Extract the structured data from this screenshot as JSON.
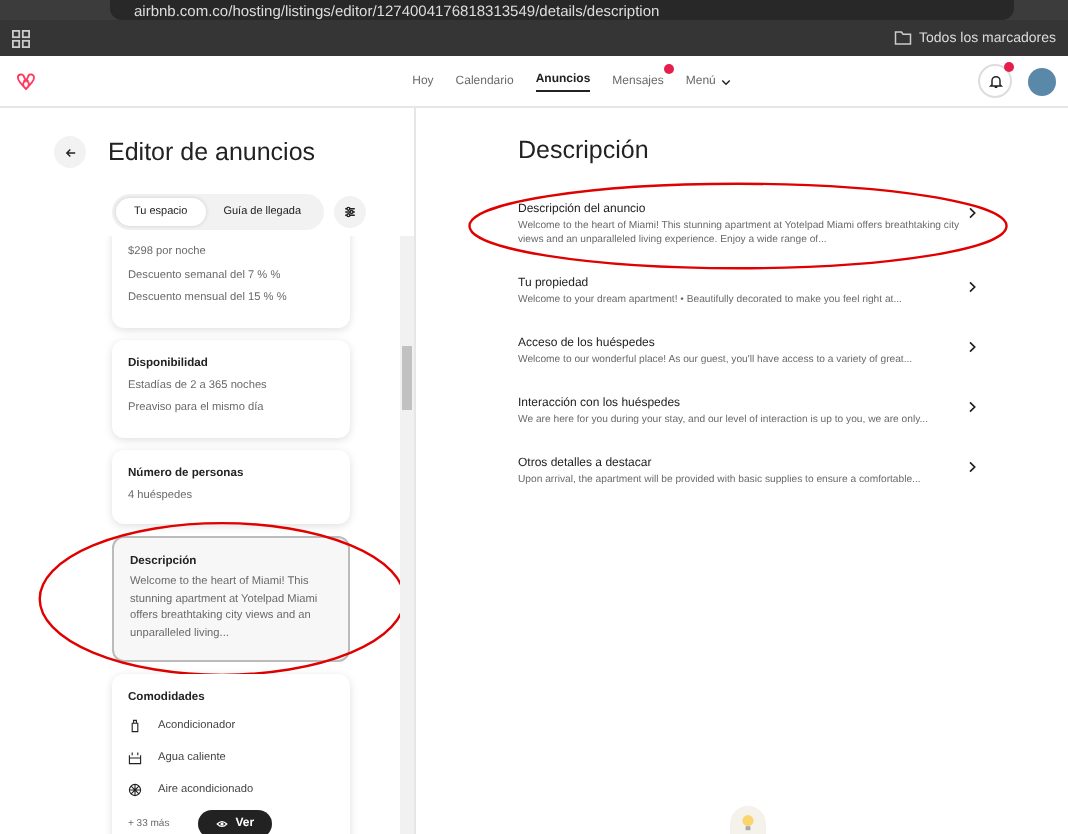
{
  "browser": {
    "url": "airbnb.com.co/hosting/listings/editor/1274004176818313549/details/description",
    "bookmarks_label": "Todos los marcadores"
  },
  "nav": {
    "items": [
      {
        "label": "Hoy",
        "selected": false,
        "badge": false
      },
      {
        "label": "Calendario",
        "selected": false,
        "badge": false
      },
      {
        "label": "Anuncios",
        "selected": true,
        "badge": false
      },
      {
        "label": "Mensajes",
        "selected": false,
        "badge": true
      }
    ],
    "menu_label": "Menú",
    "notifications_badge": true
  },
  "editor": {
    "title": "Editor de anuncios",
    "tabs": [
      {
        "label": "Tu espacio",
        "selected": true
      },
      {
        "label": "Guía de llegada",
        "selected": false
      }
    ],
    "cards": [
      {
        "kind": "text",
        "lines": [
          "$298 por noche",
          "Descuento semanal del 7 % %",
          "Descuento mensual del 15 % %"
        ],
        "highlighted": false
      },
      {
        "kind": "text",
        "title": "Disponibilidad",
        "lines": [
          "Estadías de 2 a 365 noches",
          "Preaviso para el mismo día"
        ],
        "highlighted": false
      },
      {
        "kind": "text",
        "title": "Número de personas",
        "lines": [
          "4 huéspedes"
        ],
        "highlighted": false
      },
      {
        "kind": "paragraph",
        "title": "Descripción",
        "lines": [
          "Welcome to the heart of Miami! This stunning apartment at Yotelpad Miami offers breathtaking city views and an unparalleled living..."
        ],
        "highlighted": true
      },
      {
        "kind": "amenities",
        "title": "Comodidades",
        "lines": [
          "Acondicionador",
          "Agua caliente",
          "Aire acondicionado"
        ],
        "more": "+ 33 más",
        "highlighted": false
      }
    ],
    "view_button": "Ver"
  },
  "section": {
    "title": "Descripción",
    "items": [
      {
        "title": "Descripción del anuncio",
        "text": "Welcome to the heart of Miami! This stunning apartment at Yotelpad Miami offers breathtaking city views and an unparalleled living experience. Enjoy a wide range of...",
        "highlighted": true
      },
      {
        "title": "Tu propiedad",
        "text": "Welcome to your dream apartment! • Beautifully decorated to make you feel right at...",
        "highlighted": false
      },
      {
        "title": "Acceso de los huéspedes",
        "text": "Welcome to our wonderful place! As our guest, you'll have access to a variety of great...",
        "highlighted": false
      },
      {
        "title": "Interacción con los huéspedes",
        "text": "We are here for you during your stay, and our level of interaction is up to you, we are only...",
        "highlighted": false
      },
      {
        "title": "Otros detalles a destacar",
        "text": "Upon arrival, the apartment will be provided with basic supplies to ensure a comfortable...",
        "highlighted": false
      }
    ]
  }
}
